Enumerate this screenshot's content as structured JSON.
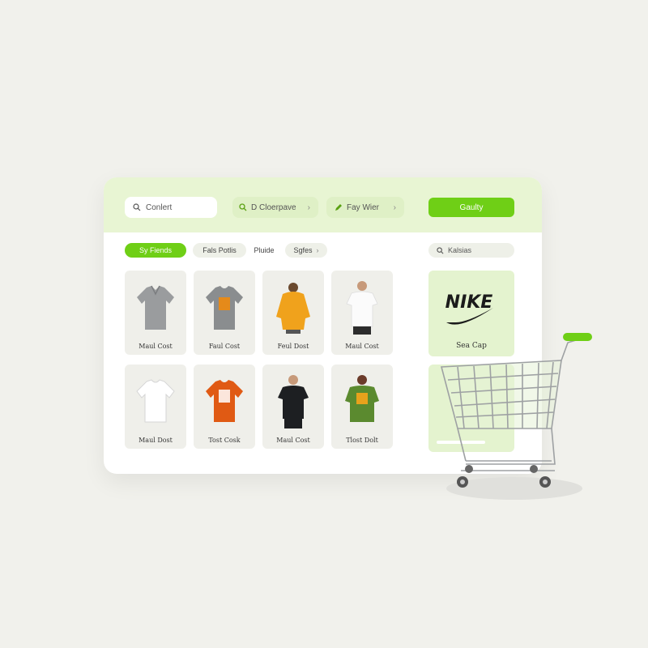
{
  "topbar": {
    "search_text": "Conlert",
    "category_text": "D Cloerpave",
    "pay_text": "Fay Wier",
    "cta_label": "Gaulty"
  },
  "filters": {
    "tabs": [
      "Sy Fiends",
      "Fals Potlis",
      "Pluide",
      "Sgfes"
    ],
    "search_text": "Kalsias"
  },
  "products": [
    {
      "label": "Maul Cost",
      "icon": "grey-polo-shirt-icon"
    },
    {
      "label": "Faul Cost",
      "icon": "grey-graphic-tshirt-icon"
    },
    {
      "label": "Feul Dost",
      "icon": "yellow-hoodie-icon"
    },
    {
      "label": "Maul Cost",
      "icon": "white-tshirt-model-icon"
    },
    {
      "label": "Maul Dost",
      "icon": "white-tshirt-icon"
    },
    {
      "label": "Tost Cosk",
      "icon": "orange-graphic-tshirt-icon"
    },
    {
      "label": "Maul Cost",
      "icon": "black-tshirt-model-icon"
    },
    {
      "label": "Tlost Dolt",
      "icon": "green-tshirt-model-icon"
    }
  ],
  "brand": {
    "logo_text": "NIKE",
    "label": "Sea Cap"
  },
  "colors": {
    "accent": "#6fcf16",
    "topbar": "#e8f5d3",
    "card": "#efefea",
    "brand_card": "#e4f3cf"
  }
}
